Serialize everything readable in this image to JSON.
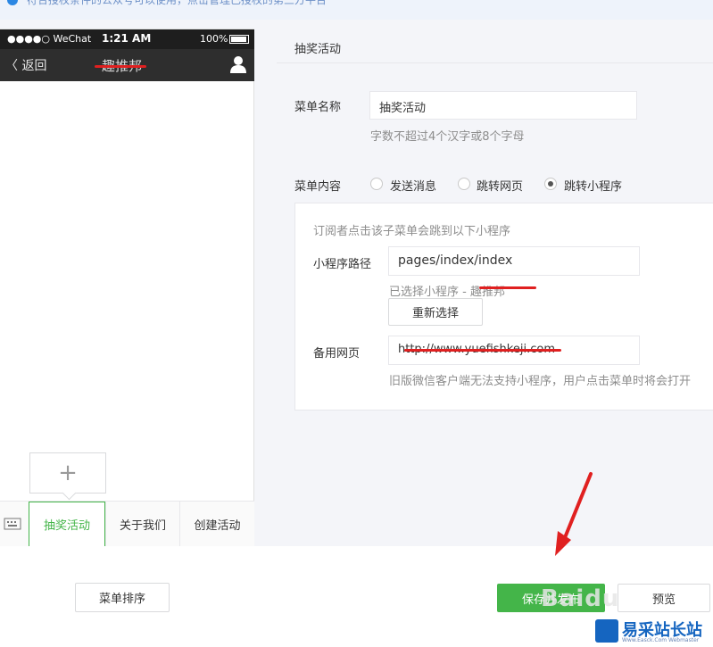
{
  "notice": {
    "text": "符合授权条件的公众号可以使用，点击管理已授权的第三方平台"
  },
  "phone": {
    "carrier": "●●●●○ WeChat",
    "time": "1:21 AM",
    "battery": "100%",
    "back_label": "〈 返回",
    "title": "趣推邦",
    "sub_add_symbol": "+",
    "menu": [
      "抽奖活动",
      "关于我们",
      "创建活动"
    ]
  },
  "editor": {
    "header": "抽奖活动",
    "name_label": "菜单名称",
    "name_value": "抽奖活动",
    "name_hint": "字数不超过4个汉字或8个字母",
    "content_label": "菜单内容",
    "options": [
      "发送消息",
      "跳转网页",
      "跳转小程序"
    ],
    "selected_option": "跳转小程序",
    "box_intro": "订阅者点击该子菜单会跳到以下小程序",
    "path_label": "小程序路径",
    "path_value": "pages/index/index",
    "selected_text": "已选择小程序 - 趣推邦",
    "reselect_label": "重新选择",
    "backup_label": "备用网页",
    "backup_value": "http://www.yuefishkeji.com",
    "backup_hint": "旧版微信客户端无法支持小程序，用户点击菜单时将会打开"
  },
  "footer": {
    "sort_label": "菜单排序",
    "save_label": "保存并发布",
    "preview_label": "预览"
  },
  "watermark": {
    "baidu": "Baidu",
    "site_name": "易采站长站",
    "site_sub": "Www.Easck.Com Webmaster"
  },
  "colors": {
    "accent_green": "#44b549",
    "annotation_red": "#e02020",
    "notice_blue": "#2b87e3"
  }
}
